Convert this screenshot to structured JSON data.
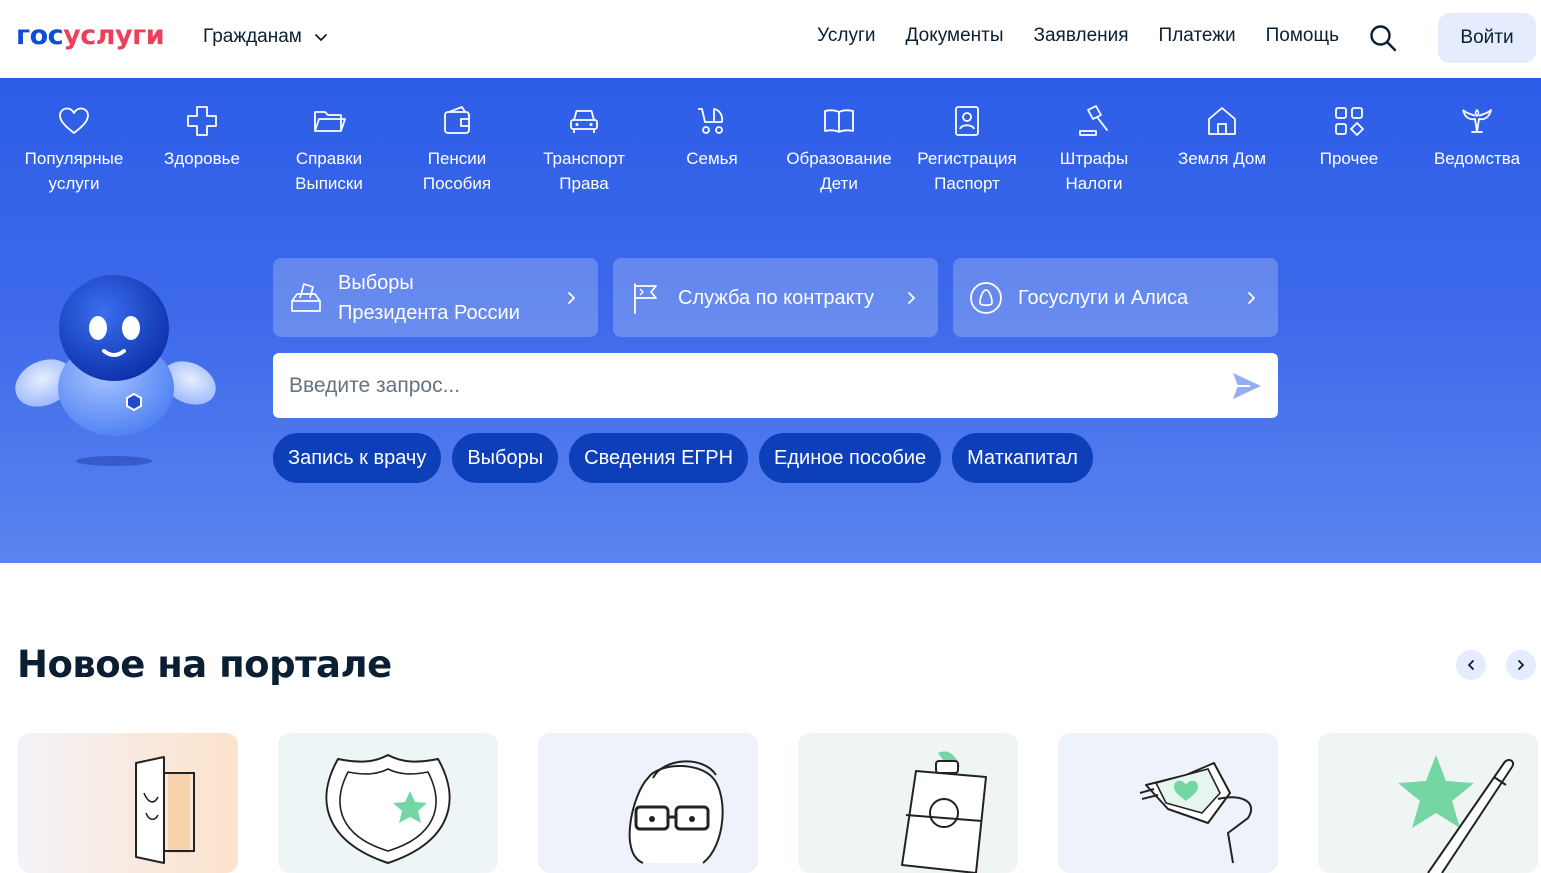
{
  "header": {
    "logo_part1": "гос",
    "logo_part2": "услуги",
    "audience": "Гражданам",
    "nav": [
      "Услуги",
      "Документы",
      "Заявления",
      "Платежи",
      "Помощь"
    ],
    "login": "Войти"
  },
  "categories": [
    {
      "label": "Популярные\nуслуги",
      "icon": "heart-icon"
    },
    {
      "label": "Здоровье",
      "icon": "medical-cross-icon"
    },
    {
      "label": "Справки\nВыписки",
      "icon": "folder-icon"
    },
    {
      "label": "Пенсии\nПособия",
      "icon": "wallet-icon"
    },
    {
      "label": "Транспорт\nПрава",
      "icon": "car-icon"
    },
    {
      "label": "Семья",
      "icon": "stroller-icon"
    },
    {
      "label": "Образование\nДети",
      "icon": "book-icon"
    },
    {
      "label": "Регистрация\nПаспорт",
      "icon": "id-card-icon"
    },
    {
      "label": "Штрафы\nНалоги",
      "icon": "gavel-icon"
    },
    {
      "label": "Земля Дом",
      "icon": "house-icon"
    },
    {
      "label": "Прочее",
      "icon": "grid-icon"
    },
    {
      "label": "Ведомства",
      "icon": "eagle-icon"
    }
  ],
  "promos": [
    {
      "label": "Выборы\nПрезидента России",
      "icon": "ballot-icon"
    },
    {
      "label": "Служба по контракту",
      "icon": "flag-icon"
    },
    {
      "label": "Госуслуги и Алиса",
      "icon": "alice-icon"
    }
  ],
  "search": {
    "placeholder": "Введите запрос..."
  },
  "quick_chips": [
    "Запись к врачу",
    "Выборы",
    "Сведения ЕГРН",
    "Единое пособие",
    "Маткапитал"
  ],
  "news": {
    "title": "Новое на портале",
    "cards": [
      {
        "icon": "passport-illustration"
      },
      {
        "icon": "shield-star-illustration"
      },
      {
        "icon": "person-glasses-illustration"
      },
      {
        "icon": "badge-illustration"
      },
      {
        "icon": "smartwatch-illustration"
      },
      {
        "icon": "star-pen-illustration"
      }
    ]
  },
  "colors": {
    "brand_blue": "#0d4cd3",
    "brand_red": "#ee3f58",
    "hero_blue": "#2d5de8",
    "chip_blue": "#0d3fb9",
    "accent_green": "#2ec77f"
  }
}
